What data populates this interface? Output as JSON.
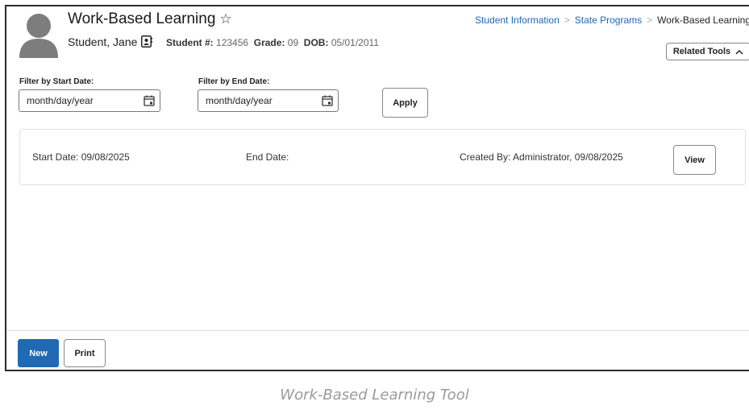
{
  "header": {
    "title": "Work-Based Learning",
    "student_name": "Student, Jane",
    "student_number_label": "Student #:",
    "student_number": "123456",
    "grade_label": "Grade:",
    "grade": "09",
    "dob_label": "DOB:",
    "dob": "05/01/2011"
  },
  "breadcrumb": {
    "items": [
      "Student Information",
      "State Programs",
      "Work-Based Learning"
    ]
  },
  "related_tools": {
    "label": "Related Tools"
  },
  "filters": {
    "start_label": "Filter by Start Date:",
    "start_value": "month/day/year",
    "end_label": "Filter by End Date:",
    "end_value": "month/day/year",
    "apply_label": "Apply"
  },
  "records": [
    {
      "start": "Start Date: 09/08/2025",
      "end": "End Date:",
      "created": "Created By: Administrator, 09/08/2025",
      "view_label": "View"
    }
  ],
  "footer": {
    "new_label": "New",
    "print_label": "Print"
  },
  "caption": "Work-Based Learning Tool",
  "colors": {
    "primary": "#1f6ab3",
    "link": "#1b6ab5"
  },
  "icons": [
    "avatar-icon",
    "star-icon",
    "contact-card-icon",
    "calendar-icon",
    "chevron-up-icon"
  ]
}
